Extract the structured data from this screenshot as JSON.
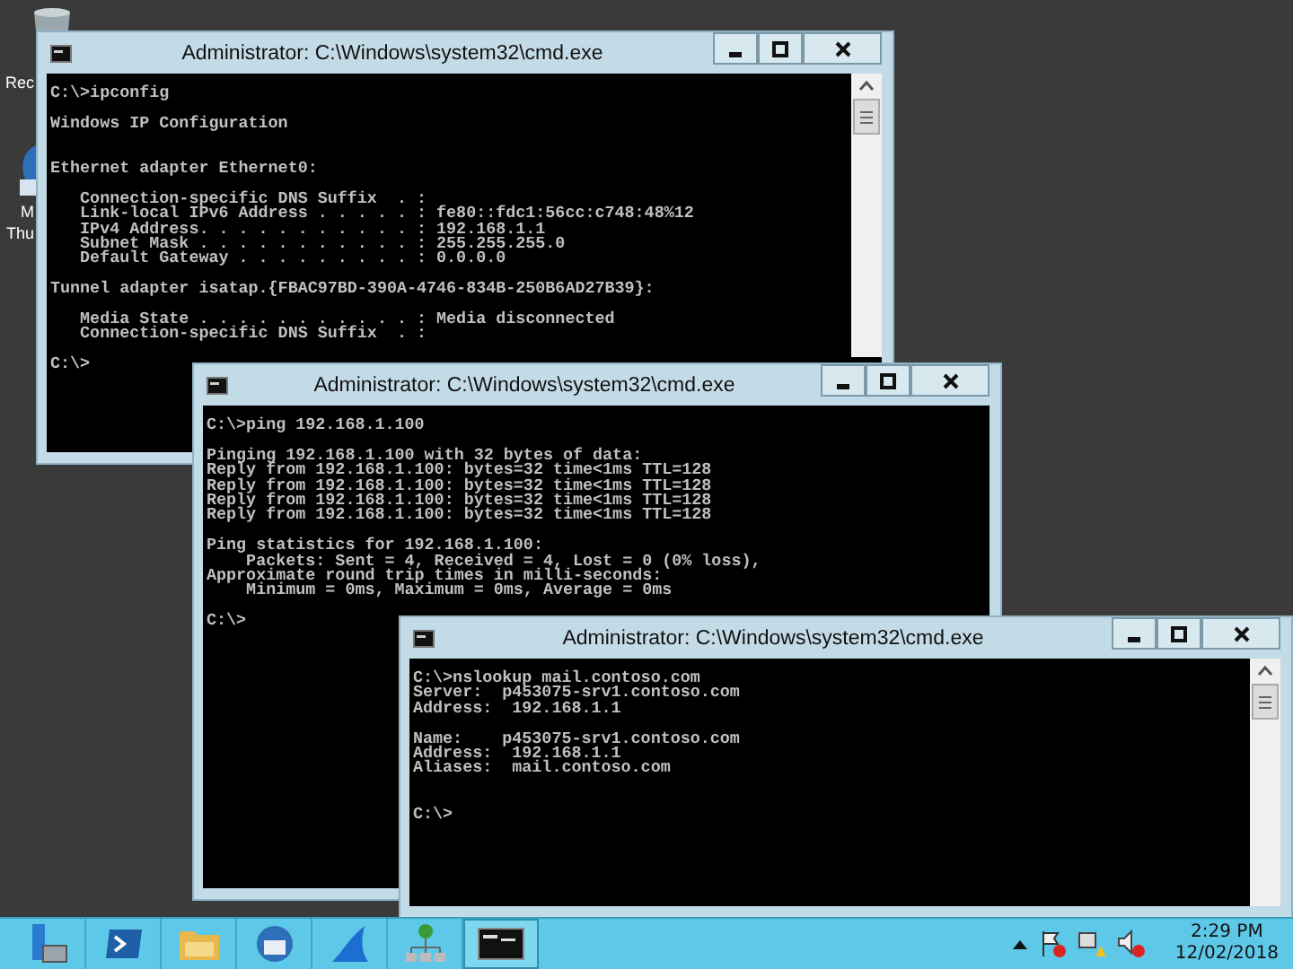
{
  "desktop_icons": [
    {
      "kind": "recycle-bin",
      "label_lines": [
        "Rec"
      ]
    },
    {
      "kind": "mail-app",
      "label_lines": [
        "M",
        "Thu"
      ]
    }
  ],
  "windows": [
    {
      "title": "Administrator: C:\\Windows\\system32\\cmd.exe",
      "scrollbar": true,
      "blocks": [
        {
          "blank_before": false,
          "double_blank_before": false,
          "lines": [
            "C:\\>ipconfig"
          ]
        },
        {
          "blank_before": true,
          "double_blank_before": false,
          "lines": [
            "Windows IP Configuration"
          ]
        },
        {
          "blank_before": true,
          "double_blank_before": true,
          "lines": [
            "Ethernet adapter Ethernet0:"
          ]
        },
        {
          "blank_before": true,
          "double_blank_before": false,
          "lines": [
            "   Connection-specific DNS Suffix  . :",
            "   Link-local IPv6 Address . . . . . : fe80::fdc1:56cc:c748:48%12",
            "   IPv4 Address. . . . . . . . . . . : 192.168.1.1",
            "   Subnet Mask . . . . . . . . . . . : 255.255.255.0",
            "   Default Gateway . . . . . . . . . : 0.0.0.0"
          ]
        },
        {
          "blank_before": true,
          "double_blank_before": false,
          "lines": [
            "Tunnel adapter isatap.{FBAC97BD-390A-4746-834B-250B6AD27B39}:"
          ]
        },
        {
          "blank_before": true,
          "double_blank_before": false,
          "lines": [
            "   Media State . . . . . . . . . . . : Media disconnected",
            "   Connection-specific DNS Suffix  . :"
          ]
        },
        {
          "blank_before": true,
          "double_blank_before": false,
          "lines": [
            "C:\\>"
          ]
        }
      ]
    },
    {
      "title": "Administrator: C:\\Windows\\system32\\cmd.exe",
      "scrollbar": false,
      "blocks": [
        {
          "blank_before": false,
          "double_blank_before": false,
          "lines": [
            "C:\\>ping 192.168.1.100"
          ]
        },
        {
          "blank_before": true,
          "double_blank_before": false,
          "lines": [
            "Pinging 192.168.1.100 with 32 bytes of data:",
            "Reply from 192.168.1.100: bytes=32 time<1ms TTL=128",
            "Reply from 192.168.1.100: bytes=32 time<1ms TTL=128",
            "Reply from 192.168.1.100: bytes=32 time<1ms TTL=128",
            "Reply from 192.168.1.100: bytes=32 time<1ms TTL=128"
          ]
        },
        {
          "blank_before": true,
          "double_blank_before": false,
          "lines": [
            "Ping statistics for 192.168.1.100:",
            "    Packets: Sent = 4, Received = 4, Lost = 0 (0% loss),",
            "Approximate round trip times in milli-seconds:",
            "    Minimum = 0ms, Maximum = 0ms, Average = 0ms"
          ]
        },
        {
          "blank_before": true,
          "double_blank_before": false,
          "lines": [
            "C:\\>"
          ]
        }
      ]
    },
    {
      "title": "Administrator: C:\\Windows\\system32\\cmd.exe",
      "scrollbar": true,
      "blocks": [
        {
          "blank_before": false,
          "double_blank_before": false,
          "lines": [
            "C:\\>nslookup mail.contoso.com",
            "Server:  p453075-srv1.contoso.com",
            "Address:  192.168.1.1"
          ]
        },
        {
          "blank_before": true,
          "double_blank_before": false,
          "lines": [
            "Name:    p453075-srv1.contoso.com",
            "Address:  192.168.1.1",
            "Aliases:  mail.contoso.com"
          ]
        },
        {
          "blank_before": true,
          "double_blank_before": true,
          "lines": [
            "C:\\>"
          ]
        }
      ]
    }
  ],
  "taskbar": {
    "items": [
      {
        "kind": "server",
        "selected": false
      },
      {
        "kind": "shell",
        "selected": false
      },
      {
        "kind": "folder",
        "selected": false
      },
      {
        "kind": "mail",
        "selected": false
      },
      {
        "kind": "fin",
        "selected": false
      },
      {
        "kind": "network",
        "selected": false
      },
      {
        "kind": "console",
        "selected": true
      }
    ],
    "clock": {
      "time": "2:29 PM",
      "date": "12/02/2018"
    }
  }
}
